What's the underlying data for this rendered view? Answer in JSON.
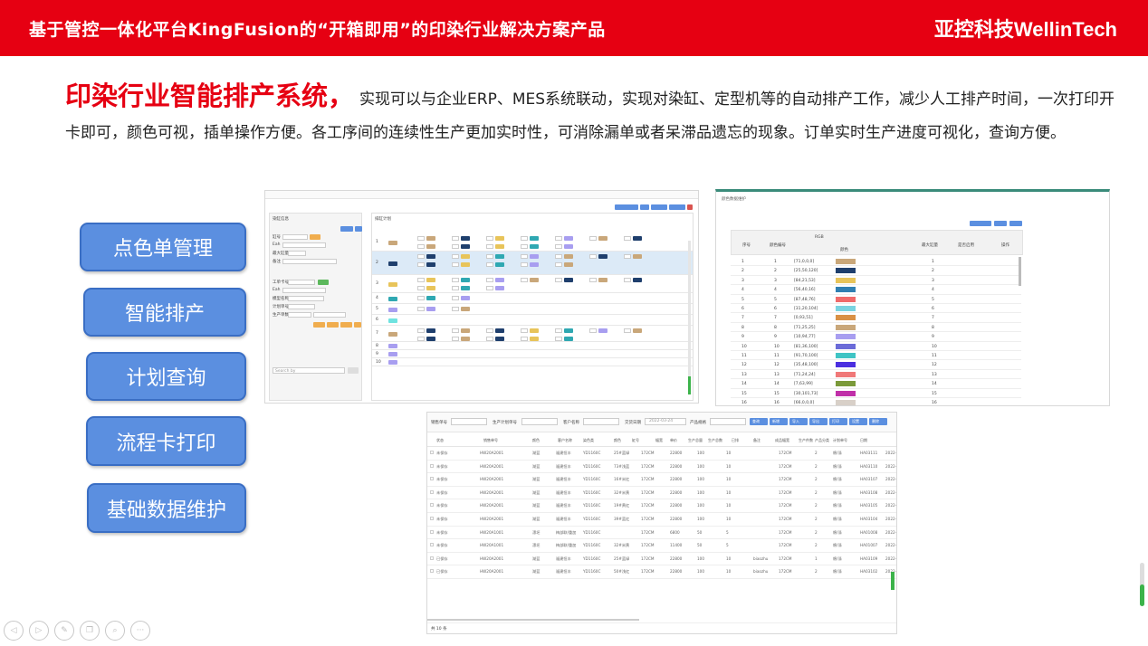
{
  "header": {
    "title": "基于管控一体化平台KingFusion的“开箱即用”的印染行业解决方案产品",
    "logo": "亚控科技WellinTech"
  },
  "intro": {
    "highlight": "印染行业智能排产系统，",
    "text": "实现可以与企业ERP、MES系统联动，实现对染缸、定型机等的自动排产工作，减少人工排产时间，一次打印开卡即可，颜色可视，插单操作方便。各工序间的连续性生产更加实时性，可消除漏单或者呆滞品遗忘的现象。订单实时生产进度可视化，查询方便。"
  },
  "menu": [
    {
      "label": "点色单管理"
    },
    {
      "label": "智能排产"
    },
    {
      "label": "计划查询"
    },
    {
      "label": "流程卡打印"
    },
    {
      "label": "基础数据维护"
    }
  ],
  "screenshot1": {
    "left_title": "染缸信息",
    "right_title": "排缸计划",
    "form_labels": [
      "缸号",
      "Eah",
      "最大缸量",
      "备注",
      "工单卡号",
      "Eah",
      "模型名称",
      "计划单号",
      "生产单数"
    ],
    "row_labels": [
      "1",
      "2",
      "3",
      "4",
      "5",
      "6",
      "7",
      "8",
      "9",
      "10"
    ],
    "search_placeholder": "Search by"
  },
  "screenshot2": {
    "title": "颜色数据维护",
    "headers": [
      "序号",
      "颜色编号",
      "RGB",
      "颜色",
      "最大缸量",
      "是否启用",
      "操作"
    ],
    "rows": [
      {
        "no": "1",
        "rgb": "[71,0,0,0]",
        "color": "#c9a77a",
        "limit": "1"
      },
      {
        "no": "2",
        "rgb": "[25,50,120]",
        "color": "#1f3f6d",
        "limit": "2"
      },
      {
        "no": "3",
        "rgb": "[84,21,53]",
        "color": "#e8c45a",
        "limit": "3"
      },
      {
        "no": "4",
        "rgb": "[56,40,16]",
        "color": "#2f7fb2",
        "limit": "4"
      },
      {
        "no": "5",
        "rgb": "[87,48,76]",
        "color": "#f06a6a",
        "limit": "5"
      },
      {
        "no": "6",
        "rgb": "[31,20,104]",
        "color": "#79d3e0",
        "limit": "6"
      },
      {
        "no": "7",
        "rgb": "[0,93,51]",
        "color": "#d99045",
        "limit": "7"
      },
      {
        "no": "8",
        "rgb": "[71,25,25]",
        "color": "#c9a77a",
        "limit": "8"
      },
      {
        "no": "9",
        "rgb": "[10,94,77]",
        "color": "#a89ef0",
        "limit": "9"
      },
      {
        "no": "10",
        "rgb": "[81,36,100]",
        "color": "#6b6bd8",
        "limit": "10"
      },
      {
        "no": "11",
        "rgb": "[91,70,100]",
        "color": "#3fc4c4",
        "limit": "11"
      },
      {
        "no": "12",
        "rgb": "[35,48,100]",
        "color": "#4b2fe0",
        "limit": "12"
      },
      {
        "no": "13",
        "rgb": "[71,24,24]",
        "color": "#f07878",
        "limit": "13"
      },
      {
        "no": "14",
        "rgb": "[7,63,99]",
        "color": "#7b9a3a",
        "limit": "14"
      },
      {
        "no": "15",
        "rgb": "[30,101,73]",
        "color": "#c02fa8",
        "limit": "15"
      },
      {
        "no": "16",
        "rgb": "[66,0,0,0]",
        "color": "#d8d0c8",
        "limit": "16"
      }
    ]
  },
  "screenshot3": {
    "filters": [
      "销售单号",
      "生产计划单号",
      "客户名称",
      "交货日期",
      "产品规格"
    ],
    "date_value": "2022-03-24",
    "actions": [
      "查询",
      "新增",
      "导入",
      "导出",
      "打印",
      "设置",
      "删除"
    ],
    "headers": [
      "状态",
      "销售单号",
      "颜色",
      "客户名称",
      "染色类",
      "颜色",
      "缸号",
      "幅宽",
      "单价",
      "生产总量",
      "生产总数",
      "已排",
      "备注",
      "成品幅宽",
      "生产件数",
      "产品分类",
      "计划单号",
      "日期"
    ],
    "rows": [
      {
        "status": "未保存",
        "order": "HW20A2001",
        "c1": "湖蓝",
        "cust": "福建恒丰",
        "f1": "YD1160C",
        "n": "25#蓝绿",
        "w": "172CM",
        "q1": "22800",
        "q2": "100",
        "q3": "10",
        "note": "",
        "width": "172CM",
        "cnt": "2",
        "cat": "棉/涤",
        "plan": "HA03111",
        "d": "2022-0"
      },
      {
        "status": "未保存",
        "order": "HW20A2001",
        "c1": "湖蓝",
        "cust": "福建恒丰",
        "f1": "YD1160C",
        "n": "73#浅蓝",
        "w": "172CM",
        "q1": "22800",
        "q2": "100",
        "q3": "10",
        "note": "",
        "width": "172CM",
        "cnt": "2",
        "cat": "棉/涤",
        "plan": "HA03110",
        "d": "2022-0"
      },
      {
        "status": "未保存",
        "order": "HW20A2001",
        "c1": "湖蓝",
        "cust": "福建恒丰",
        "f1": "YD1160C",
        "n": "16#米红",
        "w": "172CM",
        "q1": "22800",
        "q2": "100",
        "q3": "10",
        "note": "",
        "width": "172CM",
        "cnt": "2",
        "cat": "棉/涤",
        "plan": "HA03107",
        "d": "2022-0"
      },
      {
        "status": "未保存",
        "order": "HW20A2001",
        "c1": "湖蓝",
        "cust": "福建恒丰",
        "f1": "YD1160C",
        "n": "32#米黄",
        "w": "172CM",
        "q1": "22800",
        "q2": "100",
        "q3": "10",
        "note": "",
        "width": "172CM",
        "cnt": "2",
        "cat": "棉/涤",
        "plan": "HA03108",
        "d": "2022-0"
      },
      {
        "status": "未保存",
        "order": "HW20A2001",
        "c1": "湖蓝",
        "cust": "福建恒丰",
        "f1": "YD1160C",
        "n": "19#黄红",
        "w": "172CM",
        "q1": "22800",
        "q2": "100",
        "q3": "10",
        "note": "",
        "width": "172CM",
        "cnt": "2",
        "cat": "棉/涤",
        "plan": "HA03105",
        "d": "2022-0"
      },
      {
        "status": "未保存",
        "order": "HW20A2001",
        "c1": "湖蓝",
        "cust": "福建恒丰",
        "f1": "YD1160C",
        "n": "39#蓝红",
        "w": "172CM",
        "q1": "22800",
        "q2": "100",
        "q3": "10",
        "note": "",
        "width": "172CM",
        "cnt": "2",
        "cat": "棉/涤",
        "plan": "HA03104",
        "d": "2022-0"
      },
      {
        "status": "未保存",
        "order": "HW20A1001",
        "c1": "漂坯",
        "cust": "梅部联/重加",
        "f1": "YD1160C",
        "n": "",
        "w": "172CM",
        "q1": "6800",
        "q2": "50",
        "q3": "5",
        "note": "",
        "width": "172CM",
        "cnt": "2",
        "cat": "棉/涤",
        "plan": "HA01008",
        "d": "2022-0"
      },
      {
        "status": "未保存",
        "order": "HW20A1001",
        "c1": "漂坯",
        "cust": "梅部联/重加",
        "f1": "YD1160C",
        "n": "32#米黄",
        "w": "172CM",
        "q1": "11400",
        "q2": "50",
        "q3": "5",
        "note": "",
        "width": "172CM",
        "cnt": "2",
        "cat": "棉/涤",
        "plan": "HA01007",
        "d": "2022-0"
      },
      {
        "status": "已保存",
        "order": "HW20A2001",
        "c1": "湖蓝",
        "cust": "福建恒丰",
        "f1": "YD1160C",
        "n": "25#蓝绿",
        "w": "172CM",
        "q1": "22800",
        "q2": "100",
        "q3": "10",
        "note": "biaozhu",
        "width": "172CM",
        "cnt": "1",
        "cat": "棉/涤",
        "plan": "HA03109",
        "d": "2022-0"
      },
      {
        "status": "已保存",
        "order": "HW20A2001",
        "c1": "湖蓝",
        "cust": "福建恒丰",
        "f1": "YD1160C",
        "n": "50#浅红",
        "w": "172CM",
        "q1": "22800",
        "q2": "100",
        "q3": "10",
        "note": "biaozhu",
        "width": "172CM",
        "cnt": "2",
        "cat": "棉/涤",
        "plan": "HA03102",
        "d": "2022-0"
      }
    ],
    "pagination": "共 10 条"
  },
  "bottom_icons": [
    "prev-icon",
    "next-icon",
    "pen-icon",
    "copy-icon",
    "zoom-icon",
    "more-icon"
  ],
  "colors": {
    "brand_red": "#e60012",
    "menu_blue": "#5b8fe0",
    "menu_border": "#3a6ec4",
    "sw_gold": "#c9a77a",
    "sw_navy": "#1f3f6d",
    "sw_yellow": "#e8c45a",
    "sw_teal": "#2fa8b2",
    "sw_lilac": "#a89ef0"
  }
}
